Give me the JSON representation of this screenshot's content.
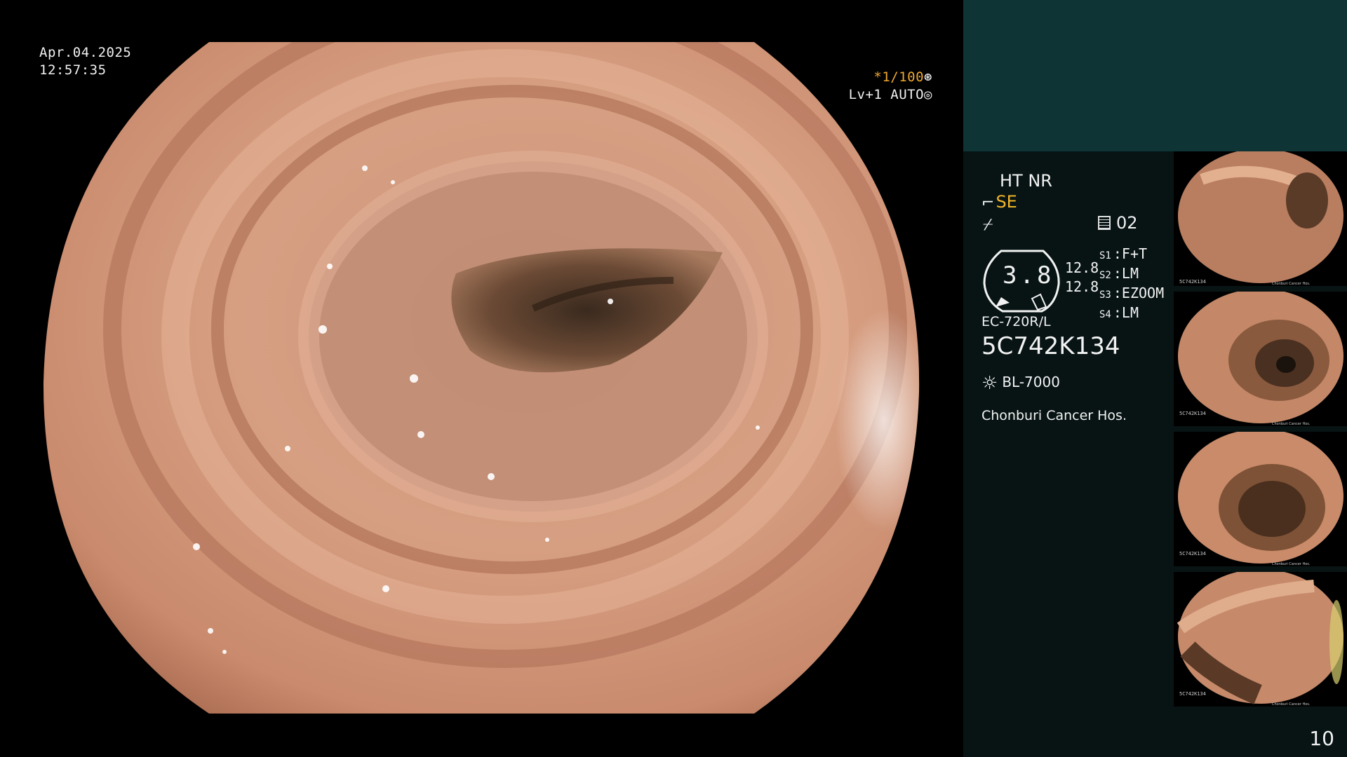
{
  "overlay": {
    "date": "Apr.04.2025",
    "time": "12:57:35",
    "shutter": "*1/100",
    "shutter_icon": "aperture-icon",
    "level": "Lv+1 AUTO",
    "level_icon": "iris-icon"
  },
  "info_panel": {
    "ht_nr": "HT NR",
    "se": "SE",
    "ff_symbol": "⌿",
    "memory": "02",
    "gauge_value": "3.8",
    "scale_values": [
      "12.8",
      "12.8"
    ],
    "s_settings": [
      {
        "key": "S1",
        "value": "F+T"
      },
      {
        "key": "S2",
        "value": "LM"
      },
      {
        "key": "S3",
        "value": "EZOOM"
      },
      {
        "key": "S4",
        "value": "LM"
      }
    ],
    "scope_model": "EC-720R/L",
    "scope_serial": "5C742K134",
    "light_source": "BL-7000",
    "hospital": "Chonburi Cancer Hos."
  },
  "thumbnails": [
    {
      "caption": "5C742K134",
      "footer": "Chonburi Cancer Hos."
    },
    {
      "caption": "5C742K134",
      "footer": "Chonburi Cancer Hos."
    },
    {
      "caption": "5C742K134",
      "footer": "Chonburi Cancer Hos."
    },
    {
      "caption": "5C742K134",
      "footer": "Chonburi Cancer Hos."
    }
  ],
  "page_number": "10",
  "colors": {
    "accent_orange": "#f0a830",
    "panel_teal": "#0e3436",
    "panel_dark": "#081414"
  }
}
